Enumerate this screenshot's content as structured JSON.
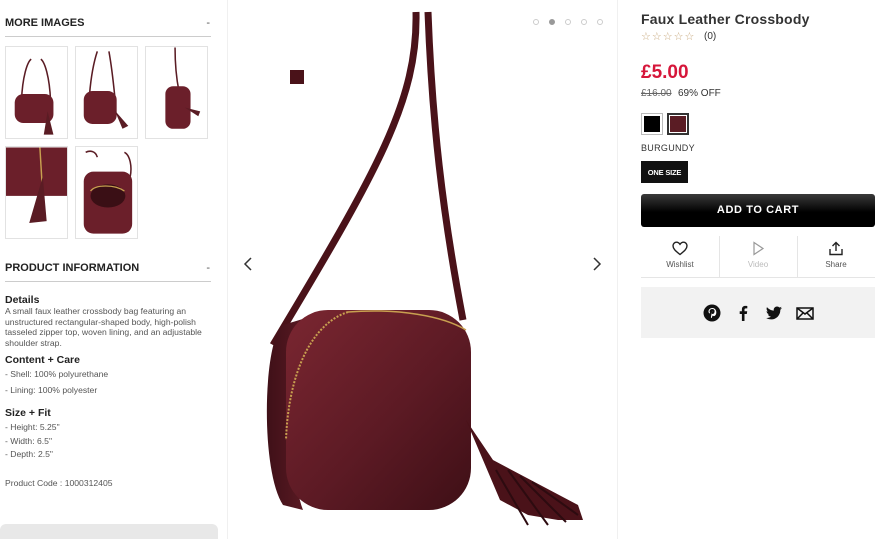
{
  "more_images": {
    "heading": "MORE IMAGES",
    "toggle": "-",
    "thumbnails": [
      "bag-front-view",
      "bag-side-view",
      "bag-strap-view",
      "bag-tassel-closeup",
      "bag-open-interior"
    ]
  },
  "product_information": {
    "heading": "PRODUCT INFORMATION",
    "toggle": "-",
    "details_title": "Details",
    "details_text": "A small faux leather crossbody bag featuring an unstructured rectangular-shaped body, high-polish tasseled zipper top, woven lining, and an adjustable shoulder strap.",
    "content_title": "Content + Care",
    "content_items": [
      "- Shell: 100% polyurethane",
      "- Lining: 100% polyester"
    ],
    "size_title": "Size + Fit",
    "size_items": [
      "- Height: 5.25\"",
      "- Width: 6.5\"",
      "- Depth: 2.5\""
    ],
    "product_code": "Product Code : 1000312405"
  },
  "gallery": {
    "slide_count": 5,
    "active_slide": 2,
    "prev_icon": "chevron-left-icon",
    "next_icon": "chevron-right-icon"
  },
  "product": {
    "title": "Faux Leather Crossbody",
    "stars": "☆☆☆☆☆",
    "review_count": "(0)",
    "price": "£5.00",
    "original_price": "£16.00",
    "discount": "69% OFF",
    "colors": [
      {
        "name": "BLACK",
        "hex": "#000000"
      },
      {
        "name": "BURGUNDY",
        "hex": "#5a1c24"
      }
    ],
    "selected_color": "BURGUNDY",
    "size": "ONE SIZE",
    "add_to_cart": "ADD TO CART"
  },
  "actions": {
    "wishlist": "Wishlist",
    "video": "Video",
    "share": "Share"
  },
  "social": [
    "pinterest-icon",
    "facebook-icon",
    "twitter-icon",
    "email-icon"
  ],
  "colors": {
    "price_red": "#d6163a",
    "burgundy": "#5a1c24",
    "button_black": "#111111"
  }
}
